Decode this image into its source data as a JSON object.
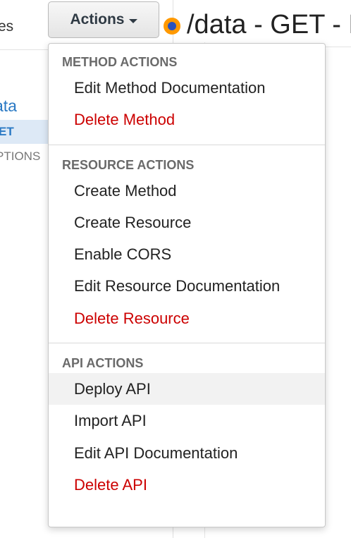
{
  "left_panel": {
    "top_label": "es",
    "tree": {
      "resource_label": "ata",
      "method_label": "ET",
      "options_label": "PTIONS"
    }
  },
  "toolbar": {
    "actions_label": "Actions"
  },
  "header": {
    "title": "/data - GET - M"
  },
  "menu": {
    "sections": [
      {
        "header": "METHOD ACTIONS",
        "items": [
          {
            "label": "Edit Method Documentation"
          },
          {
            "label": "Delete Method"
          }
        ]
      },
      {
        "header": "RESOURCE ACTIONS",
        "items": [
          {
            "label": "Create Method"
          },
          {
            "label": "Create Resource"
          },
          {
            "label": "Enable CORS"
          },
          {
            "label": "Edit Resource Documentation"
          },
          {
            "label": "Delete Resource"
          }
        ]
      },
      {
        "header": "API ACTIONS",
        "items": [
          {
            "label": "Deploy API"
          },
          {
            "label": "Import API"
          },
          {
            "label": "Edit API Documentation"
          },
          {
            "label": "Delete API"
          }
        ]
      }
    ]
  },
  "colors": {
    "danger": "#cc0000",
    "link": "#2a79c4",
    "status_dot": "#ff9900",
    "selected_row": "#dde9f6"
  }
}
